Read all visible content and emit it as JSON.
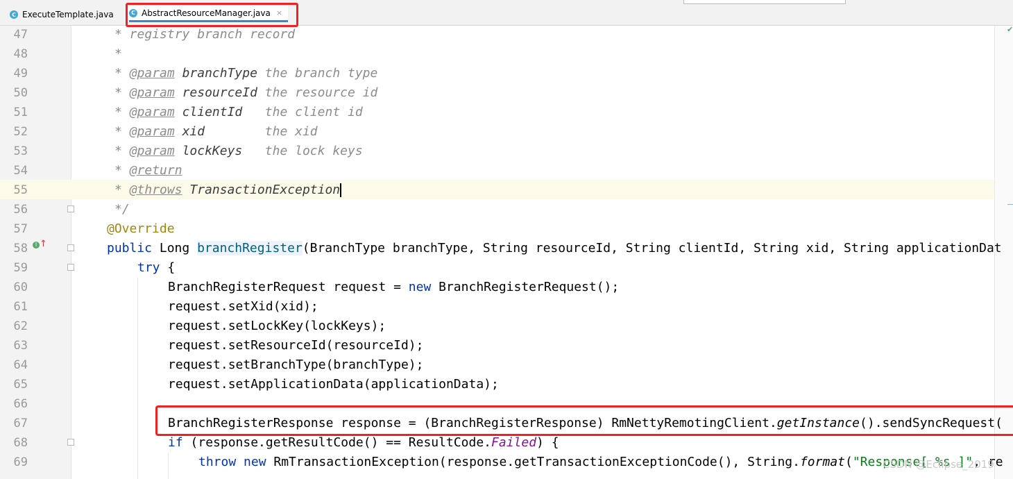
{
  "tabs": [
    {
      "label": "ExecuteTemplate.java",
      "icon": "class-icon"
    },
    {
      "label": "AbstractResourceManager.java",
      "icon": "class-icon",
      "active": true,
      "close": "×"
    }
  ],
  "line_numbers": [
    "47",
    "48",
    "49",
    "50",
    "51",
    "52",
    "53",
    "54",
    "55",
    "56",
    "57",
    "58",
    "59",
    "60",
    "61",
    "62",
    "63",
    "64",
    "65",
    "66",
    "67",
    "68",
    "69"
  ],
  "code": {
    "l47": "* registry branch record",
    "l48": "*",
    "l49": {
      "star": "* ",
      "tag": "@param",
      "name": "branchType",
      "desc": "the branch type"
    },
    "l50": {
      "star": "* ",
      "tag": "@param",
      "name": "resourceId",
      "desc": "the resource id"
    },
    "l51": {
      "star": "* ",
      "tag": "@param",
      "name": "clientId",
      "desc": "the client id"
    },
    "l52": {
      "star": "* ",
      "tag": "@param",
      "name": "xid",
      "desc": "the xid"
    },
    "l53": {
      "star": "* ",
      "tag": "@param",
      "name": "lockKeys",
      "desc": "the lock keys"
    },
    "l54": {
      "star": "* ",
      "tag": "@return"
    },
    "l55": {
      "star": "* ",
      "tag": "@throws",
      "name": "TransactionException"
    },
    "l56": "*/",
    "l57": "@Override",
    "l58": {
      "kw": "public",
      "type": "Long",
      "method": "branchRegister",
      "params": "(BranchType branchType, String resourceId, String clientId, String xid, String applicationDat"
    },
    "l59": {
      "kw": "try",
      "rest": " {"
    },
    "l60": {
      "a": "BranchRegisterRequest request = ",
      "kw": "new",
      "b": " BranchRegisterRequest();"
    },
    "l61": "request.setXid(xid);",
    "l62": "request.setLockKey(lockKeys);",
    "l63": "request.setResourceId(resourceId);",
    "l64": "request.setBranchType(branchType);",
    "l65": "request.setApplicationData(applicationData);",
    "l66": "",
    "l67": {
      "a": "BranchRegisterResponse response = (BranchRegisterResponse) RmNettyRemotingClient.",
      "italic": "getInstance",
      "b": "().sendSyncRequest("
    },
    "l68": {
      "kw": "if",
      "a": " (response.getResultCode() == ResultCode.",
      "const": "Failed",
      "b": ") {"
    },
    "l69": {
      "kw1": "throw",
      "kw2": "new",
      "a": " RmTransactionException(response.getTransactionExceptionCode(), String.",
      "italic": "format",
      "b": "(",
      "str": "\"Response[ %s ]\"",
      "c": ", re"
    }
  },
  "watermark": "CSDN @Eclipse_2019"
}
